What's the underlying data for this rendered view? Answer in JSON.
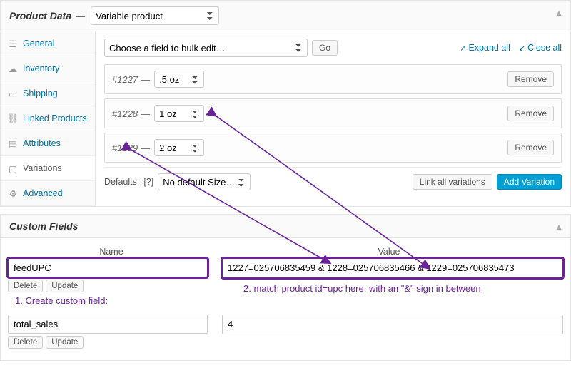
{
  "product_data": {
    "title": "Product Data",
    "type_select": "Variable product",
    "tabs": [
      {
        "label": "General",
        "icon": "settings-icon"
      },
      {
        "label": "Inventory",
        "icon": "inventory-icon"
      },
      {
        "label": "Shipping",
        "icon": "shipping-icon"
      },
      {
        "label": "Linked Products",
        "icon": "link-icon"
      },
      {
        "label": "Attributes",
        "icon": "attributes-icon"
      },
      {
        "label": "Variations",
        "icon": "variations-icon",
        "active": true
      },
      {
        "label": "Advanced",
        "icon": "advanced-icon"
      }
    ],
    "bulk_placeholder": "Choose a field to bulk edit…",
    "go_label": "Go",
    "expand_all_label": "Expand all",
    "close_all_label": "Close all",
    "variations": [
      {
        "id": "#1227",
        "size": ".5 oz"
      },
      {
        "id": "#1228",
        "size": "1 oz"
      },
      {
        "id": "#1229",
        "size": "2 oz"
      }
    ],
    "remove_label": "Remove",
    "defaults_label": "Defaults:",
    "defaults_help": "[?]",
    "defaults_select": "No default Size…",
    "link_all_label": "Link all variations",
    "add_variation_label": "Add Variation"
  },
  "custom_fields": {
    "title": "Custom Fields",
    "col_name": "Name",
    "col_value": "Value",
    "rows": [
      {
        "name": "feedUPC",
        "value": "1227=025706835459 & 1228=025706835466 & 1229=025706835473",
        "highlight": true
      },
      {
        "name": "total_sales",
        "value": "4"
      }
    ],
    "delete_label": "Delete",
    "update_label": "Update"
  },
  "annotations": {
    "a1": "1. Create custom field:",
    "a2": "2. match product id=upc here, with an \"&\" sign in between"
  }
}
